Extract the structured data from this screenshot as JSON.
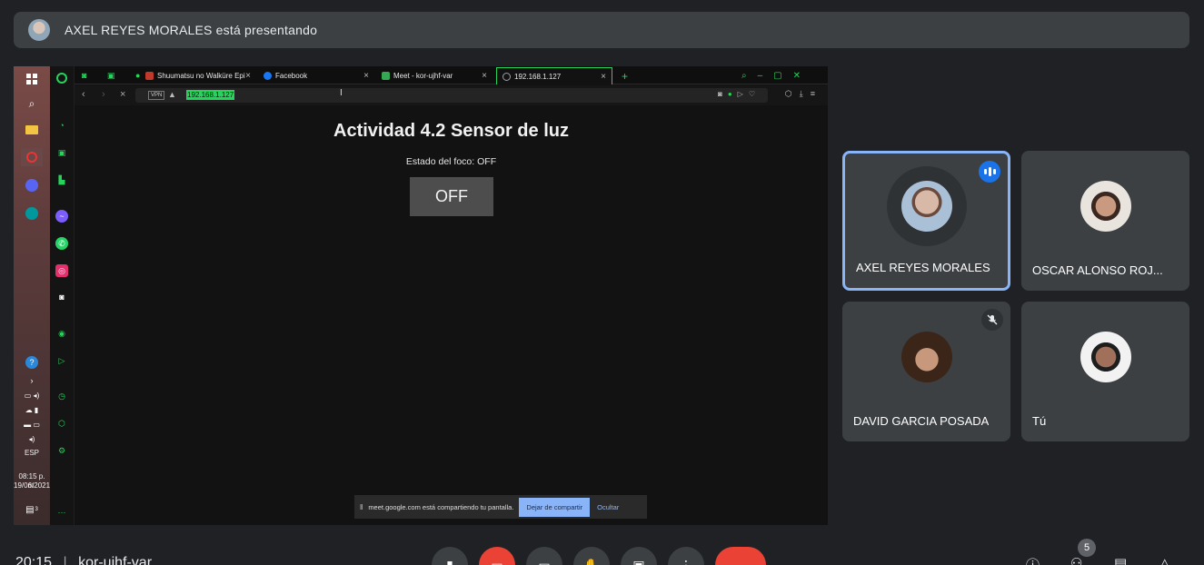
{
  "banner": {
    "text": "AXEL REYES MORALES está presentando"
  },
  "shared_screen": {
    "taskbar": {
      "language": "ESP",
      "time": "08:15 p. m.",
      "date": "19/06/2021",
      "notification_count": "3"
    },
    "browser": {
      "tabs": [
        {
          "label": "Shuumatsu no Walküre Epi",
          "favicon_color": "#c0392b"
        },
        {
          "label": "Facebook",
          "favicon_color": "#1877f2"
        },
        {
          "label": "Meet - kor-ujhf-var",
          "favicon_color": "#34a853"
        },
        {
          "label": "192.168.1.127",
          "favicon_color": "#9aa0a6"
        }
      ],
      "vpn_label": "VPN",
      "url": "192.168.1.127"
    },
    "page": {
      "title": "Actividad 4.2 Sensor de luz",
      "status": "Estado del foco: OFF",
      "button_label": "OFF"
    },
    "share_bar": {
      "message": "meet.google.com está compartiendo tu pantalla.",
      "stop_label": "Dejar de compartir",
      "hide_label": "Ocultar"
    }
  },
  "participants": [
    {
      "name": "AXEL REYES MORALES",
      "speaking": true
    },
    {
      "name": "OSCAR ALONSO ROJ..."
    },
    {
      "name": "DAVID GARCIA POSADA",
      "muted": true
    },
    {
      "name": "Tú"
    }
  ],
  "footer": {
    "time": "20:15",
    "meeting_code": "kor-ujhf-var",
    "participant_count": "5"
  },
  "colors": {
    "accent_blue": "#8ab4f8",
    "end_call_red": "#ea4335",
    "opera_green": "#27d45b"
  }
}
